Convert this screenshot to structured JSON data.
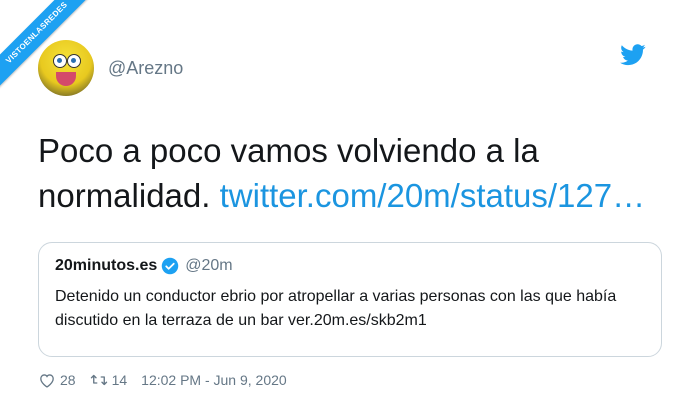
{
  "watermark": {
    "text": "VISTOENLASREDES"
  },
  "tweet": {
    "handle": "@Arezno",
    "text": "Poco a poco vamos volviendo a la normalidad. ",
    "link": "twitter.com/20m/status/127…",
    "likes": "28",
    "retweets": "14",
    "timestamp": "12:02 PM - Jun 9, 2020"
  },
  "quoted": {
    "name": "20minutos.es",
    "handle": "@20m",
    "text": "Detenido un conductor ebrio por atropellar a varias personas con las que había discutido en la terraza de un bar ver.20m.es/skb2m1"
  },
  "colors": {
    "accent": "#1da1f2",
    "link": "#1b95e0",
    "muted": "#657786",
    "border": "#ccd6dd"
  },
  "icons": [
    "twitter-bird-icon",
    "verified-icon",
    "heart-icon",
    "retweet-icon"
  ]
}
